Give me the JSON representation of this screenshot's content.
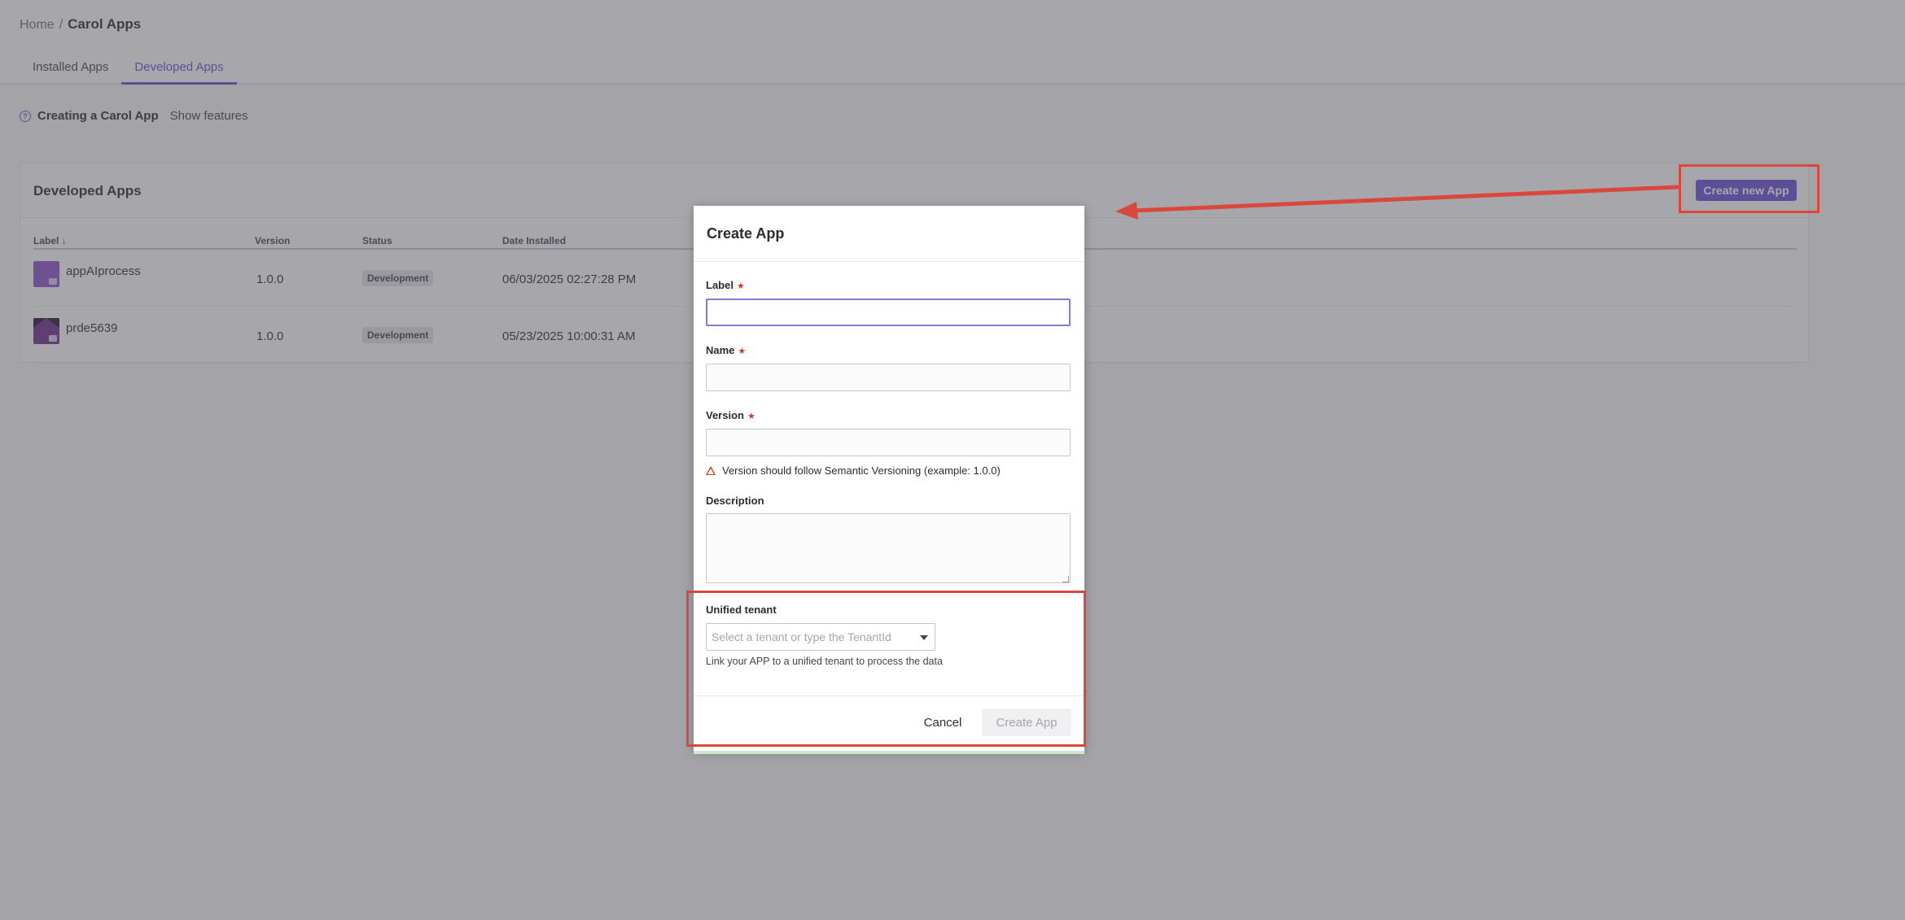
{
  "breadcrumb": {
    "home": "Home",
    "separator": "/",
    "current": "Carol Apps"
  },
  "tabs": [
    {
      "label": "Installed Apps",
      "active": false
    },
    {
      "label": "Developed Apps",
      "active": true
    }
  ],
  "help": {
    "title": "Creating a Carol App",
    "link": "Show features"
  },
  "card": {
    "title": "Developed Apps",
    "create_button": "Create new App",
    "columns": {
      "label": "Label",
      "sort_indicator": "↓",
      "version": "Version",
      "status": "Status",
      "date": "Date Installed"
    },
    "rows": [
      {
        "label": "appAIprocess",
        "version": "1.0.0",
        "status": "Development",
        "date": "06/03/2025 02:27:28 PM"
      },
      {
        "label": "prde5639",
        "version": "1.0.0",
        "status": "Development",
        "date": "05/23/2025 10:00:31 AM"
      }
    ]
  },
  "modal": {
    "title": "Create App",
    "required_mark": "★",
    "fields": {
      "label": {
        "label": "Label",
        "value": ""
      },
      "name": {
        "label": "Name",
        "value": ""
      },
      "version": {
        "label": "Version",
        "value": "",
        "warning": "Version should follow Semantic Versioning (example: 1.0.0)"
      },
      "description": {
        "label": "Description",
        "value": ""
      },
      "tenant": {
        "label": "Unified tenant",
        "placeholder": "Select a tenant or type the TenantId",
        "hint": "Link your APP to a unified tenant to process the data"
      }
    },
    "cancel_label": "Cancel",
    "create_label": "Create App"
  },
  "colors": {
    "accent": "#6b4fd6",
    "annotation": "#d9483b",
    "required": "#d33a2c"
  },
  "icons": {
    "help": "help-circle-icon",
    "warning": "warning-triangle-icon",
    "dropdown": "chevron-down-icon"
  }
}
